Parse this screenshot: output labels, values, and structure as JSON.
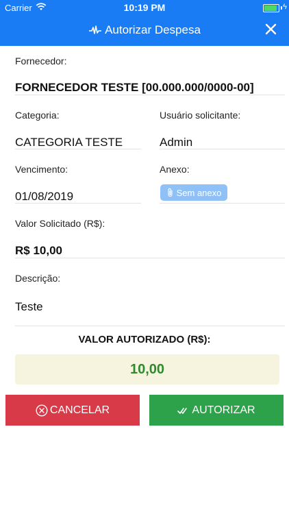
{
  "statusbar": {
    "carrier": "Carrier",
    "time": "10:19 PM",
    "battery_level": 1.0
  },
  "header": {
    "title": "Autorizar Despesa",
    "background_color": "#1a7cf5",
    "title_icon": "pulse-icon",
    "close_icon": "close-icon"
  },
  "form": {
    "supplier_label": "Fornecedor:",
    "supplier_value": "FORNECEDOR TESTE [00.000.000/0000-00]",
    "category_label": "Categoria:",
    "category_value": "CATEGORIA TESTE",
    "requester_label": "Usuário solicitante:",
    "requester_value": "Admin",
    "due_label": "Vencimento:",
    "due_value": "01/08/2019",
    "attachment_label": "Anexo:",
    "attachment_button": "Sem anexo",
    "requested_label": "Valor Solicitado (R$):",
    "requested_value": "R$ 10,00",
    "description_label": "Descrição:",
    "description_value": "Teste"
  },
  "authorized": {
    "label": "VALOR AUTORIZADO (R$):",
    "value": "10,00",
    "value_color": "#2f8a2f"
  },
  "actions": {
    "cancel_label": "CANCELAR",
    "cancel_color": "#d83a48",
    "authorize_label": "AUTORIZAR",
    "authorize_color": "#2ea14b"
  }
}
